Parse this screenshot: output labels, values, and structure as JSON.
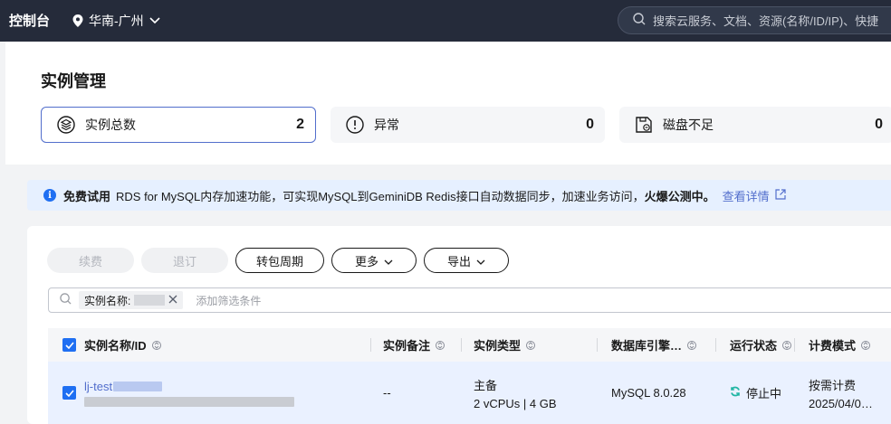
{
  "topbar": {
    "brand": "控制台",
    "region": "华南-广州",
    "search_placeholder": "搜索云服务、文档、资源(名称/ID/IP)、快捷"
  },
  "page": {
    "title": "实例管理"
  },
  "stats": [
    {
      "label": "实例总数",
      "value": "2",
      "icon": "layers-icon"
    },
    {
      "label": "异常",
      "value": "0",
      "icon": "alert-icon"
    },
    {
      "label": "磁盘不足",
      "value": "0",
      "icon": "disk-icon"
    }
  ],
  "notice": {
    "badge": "免费试用",
    "text": "RDS for MySQL内存加速功能，可实现MySQL到GeminiDB Redis接口自动数据同步，加速业务访问，",
    "highlight": "火爆公测中。",
    "link": "查看详情"
  },
  "toolbar": {
    "renew": "续费",
    "unsubscribe": "退订",
    "to_yearly": "转包周期",
    "more": "更多",
    "export": "导出"
  },
  "filter": {
    "chip_label": "实例名称:",
    "placeholder": "添加筛选条件"
  },
  "table": {
    "headers": [
      "实例名称/ID",
      "实例备注",
      "实例类型",
      "数据库引擎…",
      "运行状态",
      "计费模式"
    ],
    "rows": [
      {
        "name": "lj-test",
        "remark": "--",
        "type_main": "主备",
        "type_spec": "2 vCPUs | 4 GB",
        "engine": "MySQL 8.0.28",
        "status": "停止中",
        "billing": "按需计费",
        "billing_date": "2025/04/0…"
      }
    ]
  },
  "colors": {
    "topbar_bg": "#252b3a",
    "accent": "#526ecc",
    "checkbox": "#1f6ff2",
    "status_stopping": "#1fb5a3"
  }
}
